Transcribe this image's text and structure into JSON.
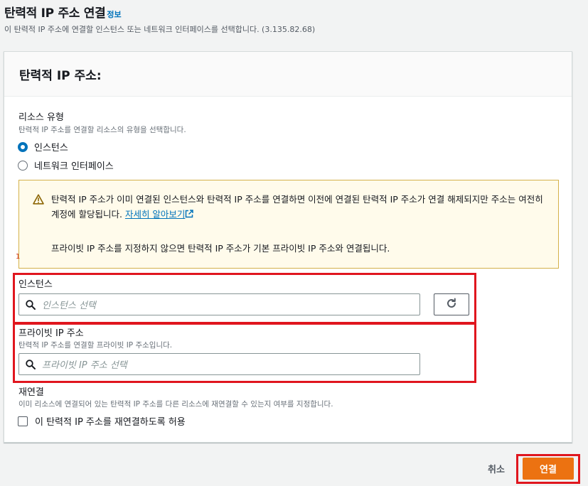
{
  "header": {
    "title": "탄력적 IP 주소 연결",
    "info_link": "정보",
    "description": "이 탄력적 IP 주소에 연결할 인스턴스 또는 네트워크 인터페이스를 선택합니다. (3.135.82.68)"
  },
  "panel": {
    "title": "탄력적 IP 주소:",
    "resource_type": {
      "label": "리소스 유형",
      "description": "탄력적 IP 주소를 연결할 리소스의 유형을 선택합니다.",
      "options": [
        {
          "label": "인스턴스",
          "selected": true
        },
        {
          "label": "네트워크 인터페이스",
          "selected": false
        }
      ]
    },
    "alert": {
      "line1": "탄력적 IP 주소가 이미 연결된 인스턴스와 탄력적 IP 주소를 연결하면 이전에 연결된 탄력적 IP 주소가 연결 해제되지만 주소는 여전히 계정에 할당됩니다.",
      "link": "자세히 알아보기",
      "line2": "프라이빗 IP 주소를 지정하지 않으면 탄력적 IP 주소가 기본 프라이빗 IP 주소와 연결됩니다."
    },
    "instance": {
      "label": "인스턴스",
      "placeholder": "인스턴스 선택"
    },
    "private_ip": {
      "label": "프라이빗 IP 주소",
      "description": "탄력적 IP 주소를 연결할 프라이빗 IP 주소입니다.",
      "placeholder": "프라이빗 IP 주소 선택"
    },
    "reassociation": {
      "label": "재연결",
      "description": "이미 리소스에 연결되어 있는 탄력적 IP 주소를 다른 리소스에 재연결할 수 있는지 여부를 지정합니다.",
      "checkbox_label": "이 탄력적 IP 주소를 재연결하도록 허용",
      "checked": false
    }
  },
  "footer": {
    "cancel_label": "취소",
    "connect_label": "연결"
  },
  "colors": {
    "primary": "#ec7211",
    "link": "#0073bb",
    "highlight": "#e0161e",
    "alert_bg": "#fffbeb"
  },
  "icons": [
    "info-link",
    "warning-icon",
    "external-link-icon",
    "search-icon",
    "refresh-icon"
  ]
}
